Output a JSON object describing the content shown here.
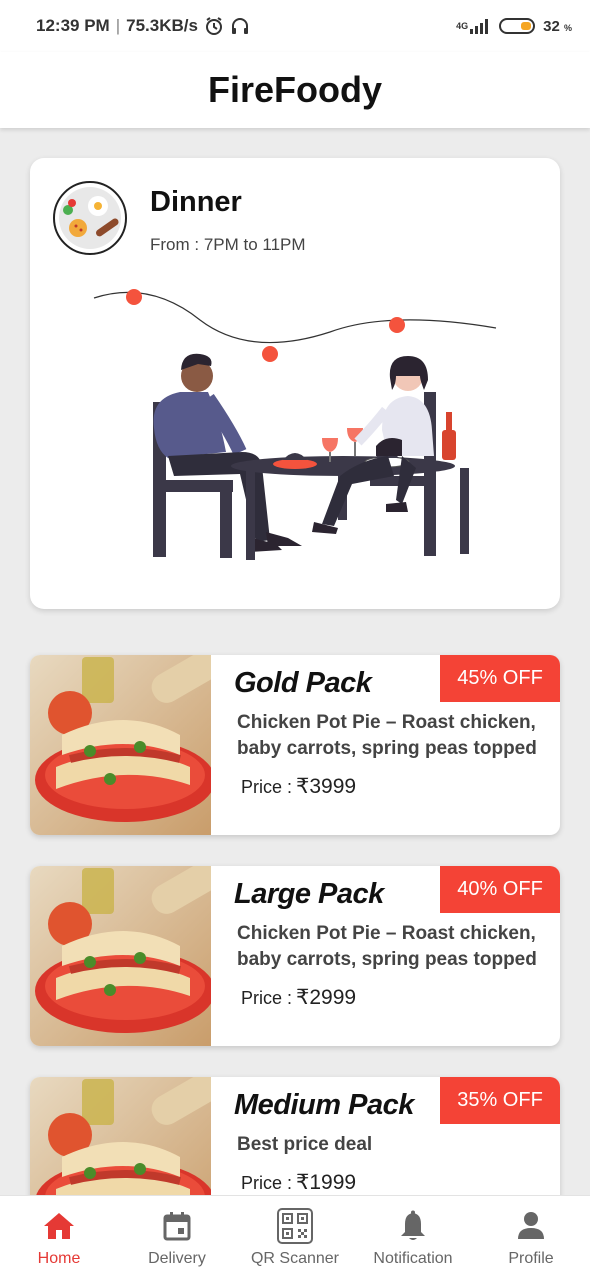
{
  "status_bar": {
    "time": "12:39 PM",
    "speed": "75.3KB/s",
    "network": "4G",
    "battery": "32",
    "battery_unit": "%",
    "icons": [
      "alarm-icon",
      "headphones-icon",
      "signal-icon",
      "battery-icon"
    ]
  },
  "app": {
    "title": "FireFoody"
  },
  "meal": {
    "title": "Dinner",
    "time_text": "From : 7PM to 11PM"
  },
  "packs": [
    {
      "name": "Gold Pack",
      "description": "Chicken Pot Pie – Roast chicken, baby carrots, spring peas topped",
      "price_label": "Price :",
      "price": "₹3999",
      "discount": "45% OFF"
    },
    {
      "name": "Large Pack",
      "description": "Chicken Pot Pie – Roast chicken, baby carrots, spring peas topped",
      "price_label": "Price :",
      "price": "₹2999",
      "discount": "40% OFF"
    },
    {
      "name": "Medium Pack",
      "description": "Best price deal",
      "price_label": "Price :",
      "price": "₹1999",
      "discount": "35% OFF"
    }
  ],
  "bottom_nav": {
    "items": [
      {
        "label": "Home",
        "icon": "home-icon",
        "active": true
      },
      {
        "label": "Delivery",
        "icon": "calendar-icon",
        "active": false
      },
      {
        "label": "QR Scanner",
        "icon": "qr-code-icon",
        "active": false
      },
      {
        "label": "Notification",
        "icon": "bell-icon",
        "active": false
      },
      {
        "label": "Profile",
        "icon": "person-icon",
        "active": false
      }
    ]
  },
  "colors": {
    "accent": "#f44336",
    "active_nav": "#e53935",
    "background": "#ececec"
  }
}
